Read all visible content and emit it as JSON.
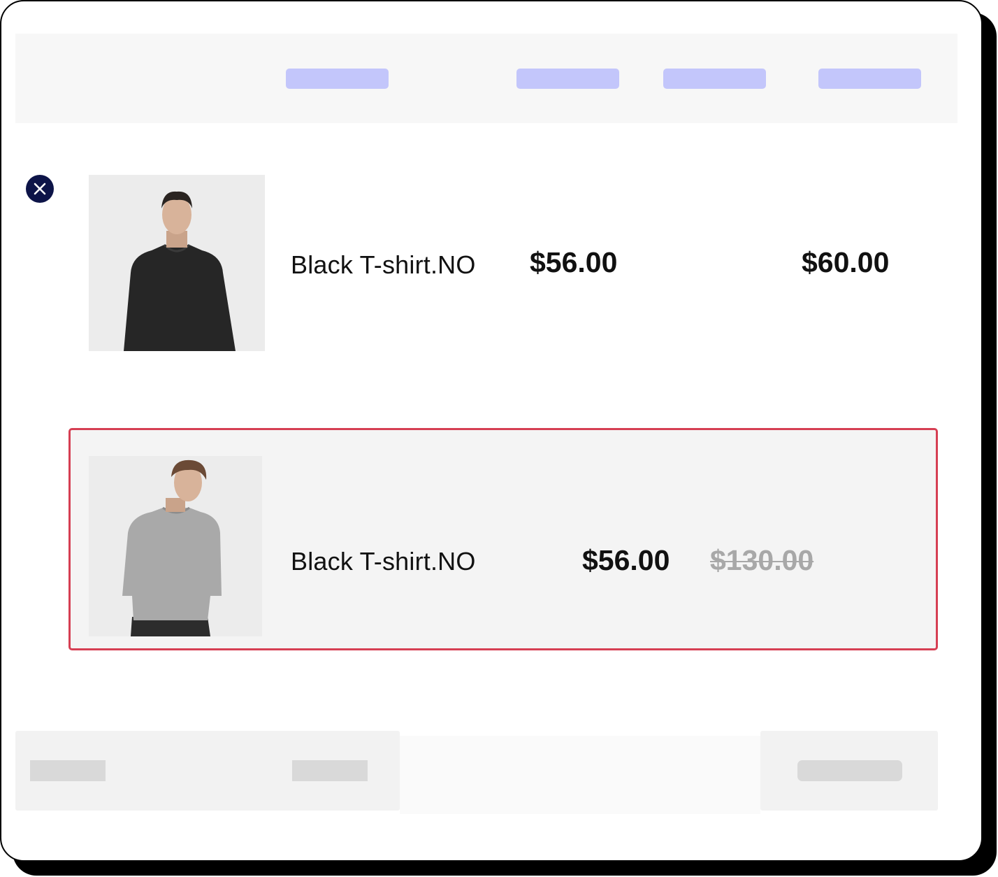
{
  "cart": {
    "remove_icon": "close-icon",
    "items": [
      {
        "product_name": "Black T-shirt.NO",
        "price": "$56.00",
        "subtotal": "$60.00",
        "image": "man-black-sweater-photo"
      },
      {
        "product_name": "Black T-shirt.NO",
        "price": "$56.00",
        "original_price": "$130.00",
        "image": "man-gray-sweater-photo",
        "highlighted": true
      }
    ]
  },
  "colors": {
    "header_placeholder": "#c3c6fb",
    "highlight_border": "#d63f53",
    "remove_button": "#0d1448",
    "strikethrough_price": "#a8a8a8"
  }
}
